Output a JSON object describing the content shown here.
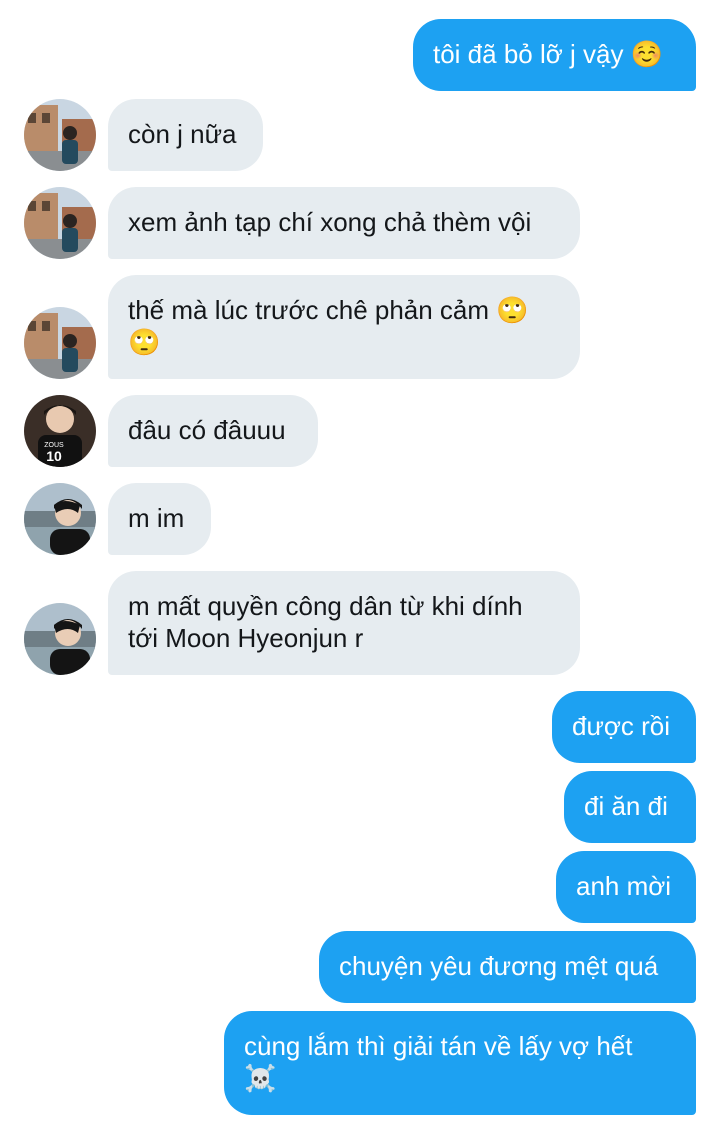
{
  "messages": [
    {
      "side": "out",
      "text": "tôi đã bỏ lỡ j vậy ☺️"
    },
    {
      "side": "in",
      "avatar": "avatar-street-icon",
      "text": "còn j nữa"
    },
    {
      "side": "in",
      "avatar": "avatar-street-icon",
      "text": "xem ảnh tạp chí xong chả thèm vội"
    },
    {
      "side": "in",
      "avatar": "avatar-street-icon",
      "text": "thế mà lúc trước chê phản cảm 🙄\n🙄"
    },
    {
      "side": "in",
      "avatar": "avatar-jersey-icon",
      "text": "đâu có đâuuu"
    },
    {
      "side": "in",
      "avatar": "avatar-lake-icon",
      "text": "m im"
    },
    {
      "side": "in",
      "avatar": "avatar-lake-icon",
      "text": "m mất quyền công dân từ khi dính\ntới Moon Hyeonjun r"
    },
    {
      "side": "out",
      "text": "được rồi"
    },
    {
      "side": "out",
      "text": "đi ăn đi"
    },
    {
      "side": "out",
      "text": "anh mời"
    },
    {
      "side": "out",
      "text": "chuyện yêu đương mệt quá"
    },
    {
      "side": "out",
      "text": "cùng lắm thì giải tán về lấy vợ hết\n☠️"
    }
  ],
  "avatars": {
    "jersey_number": "10",
    "jersey_name": "ZOUS"
  },
  "colors": {
    "outgoing_bubble": "#1da1f2",
    "incoming_bubble": "#e6ecf0",
    "incoming_text": "#14171a"
  }
}
